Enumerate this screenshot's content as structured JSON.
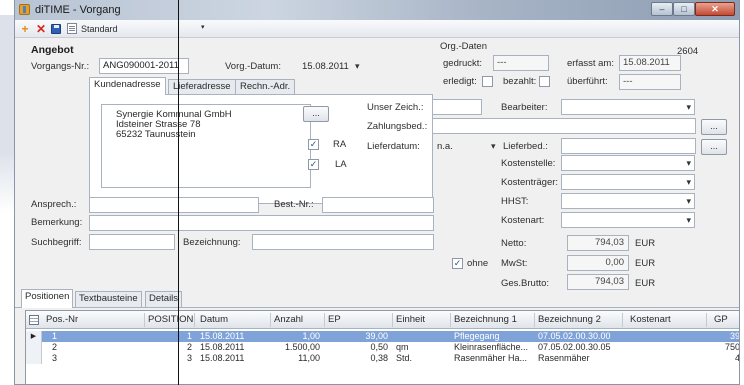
{
  "window": {
    "title": "diTIME - Vorgang",
    "min_glyph": "–",
    "max_glyph": "□",
    "close_glyph": "✕"
  },
  "toolbar": {
    "add_glyph": "+",
    "delete_glyph": "✕",
    "layout_label": "Standard",
    "dropdown_glyph": "▾"
  },
  "header": {
    "section_title": "Angebot",
    "vorgangs_nr_label": "Vorgangs-Nr.:",
    "vorgangs_nr_value": "ANG090001-2011",
    "vorg_datum_label": "Vorg.-Datum:",
    "vorg_datum_value": "15.08.2011",
    "org_daten_label": "Org.-Daten",
    "org_number": "2604",
    "gedruckt_label": "gedruckt:",
    "gedruckt_value": "---",
    "erfasst_label": "erfasst am:",
    "erfasst_value": "15.08.2011",
    "erledigt_label": "erledigt:",
    "bezahlt_label": "bezahlt:",
    "ueberfuehrt_label": "überführt:",
    "ueberfuehrt_value": "---"
  },
  "address_tabs": [
    "Kundenadresse",
    "Lieferadresse",
    "Rechn.-Adr."
  ],
  "address": {
    "line1": "Synergie Kommunal GmbH",
    "line2": "Idsteiner Strasse 78",
    "line3": "65232 Taunusstein",
    "ellipsis": "...",
    "ra_label": "RA",
    "la_label": "LA",
    "check_glyph": "✓"
  },
  "right_form": {
    "unser_zeich_label": "Unser Zeich.:",
    "bearbeiter_label": "Bearbeiter:",
    "zahlungsbed_label": "Zahlungsbed.:",
    "lieferdatum_label": "Lieferdatum:",
    "lieferdatum_value": "n.a.",
    "lieferbed_label": "Lieferbed.:",
    "kostenstelle_label": "Kostenstelle:",
    "kostentraeger_label": "Kostenträger:",
    "hhst_label": "HHST:",
    "kostenart_label": "Kostenart:",
    "ellipsis": "..."
  },
  "lower_form": {
    "ansprech_label": "Ansprech.:",
    "best_nr_label": "Best.-Nr.:",
    "bemerkung_label": "Bemerkung:",
    "suchbegriff_label": "Suchbegriff:",
    "bezeichnung_label": "Bezeichnung:"
  },
  "totals": {
    "netto_label": "Netto:",
    "netto_value": "794,03",
    "mwst_label": "MwSt:",
    "mwst_value": "0,00",
    "brutto_label": "Ges.Brutto:",
    "brutto_value": "794,03",
    "currency": "EUR",
    "ohne_label": "ohne"
  },
  "bottom_tabs": [
    "Positionen",
    "Textbausteine",
    "Details"
  ],
  "grid": {
    "columns": [
      "Pos.-Nr",
      "POSITION",
      "Datum",
      "Anzahl",
      "EP",
      "Einheit",
      "Bezeichnung 1",
      "Bezeichnung 2",
      "Kostenart",
      "GP"
    ],
    "rows": [
      {
        "pos_nr": "1",
        "position": "1",
        "datum": "15.08.2011",
        "anzahl": "1,00",
        "ep": "39,00",
        "einheit": "",
        "bez1": "Pflegegang",
        "bez2": "07.05.02.00.30.00",
        "kostenart": "",
        "gp": "39"
      },
      {
        "pos_nr": "2",
        "position": "2",
        "datum": "15.08.2011",
        "anzahl": "1.500,00",
        "ep": "0,50",
        "einheit": "qm",
        "bez1": "Kleinrasenfläche...",
        "bez2": "07.05.02.00.30.05",
        "kostenart": "",
        "gp": "750"
      },
      {
        "pos_nr": "3",
        "position": "3",
        "datum": "15.08.2011",
        "anzahl": "11,00",
        "ep": "0,38",
        "einheit": "Std.",
        "bez1": "Rasenmäher Ha...",
        "bez2": "Rasenmäher",
        "kostenart": "",
        "gp": "4"
      }
    ],
    "row_indicator": "▶"
  }
}
